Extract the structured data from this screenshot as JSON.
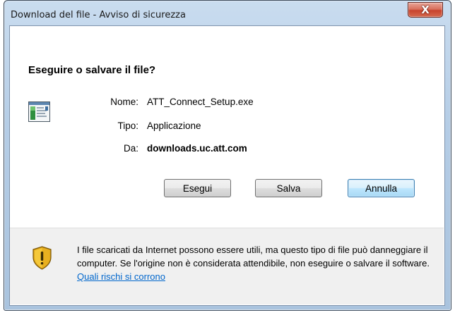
{
  "window": {
    "title": "Download del file - Avviso di sicurezza",
    "close_glyph": "X"
  },
  "prompt": {
    "heading": "Eseguire o salvare il file?"
  },
  "file_info": {
    "icon": "application-file-icon",
    "name_label": "Nome:",
    "name_value": "ATT_Connect_Setup.exe",
    "type_label": "Tipo:",
    "type_value": "Applicazione",
    "from_label": "Da:",
    "from_value": "downloads.uc.att.com"
  },
  "buttons": {
    "run": "Esegui",
    "save": "Salva",
    "cancel": "Annulla"
  },
  "warning": {
    "icon": "security-shield-icon",
    "text": "I file scaricati da Internet possono essere utili, ma questo tipo di file può danneggiare il computer. Se l'origine non è considerata attendibile, non eseguire o salvare il software. ",
    "link": "Quali rischi si corrono"
  },
  "colors": {
    "frame": "#b5cde6",
    "close_button": "#c7432d",
    "default_button_border": "#3c7fb1",
    "link": "#0066cc",
    "footer_bg": "#f0f0f0"
  }
}
